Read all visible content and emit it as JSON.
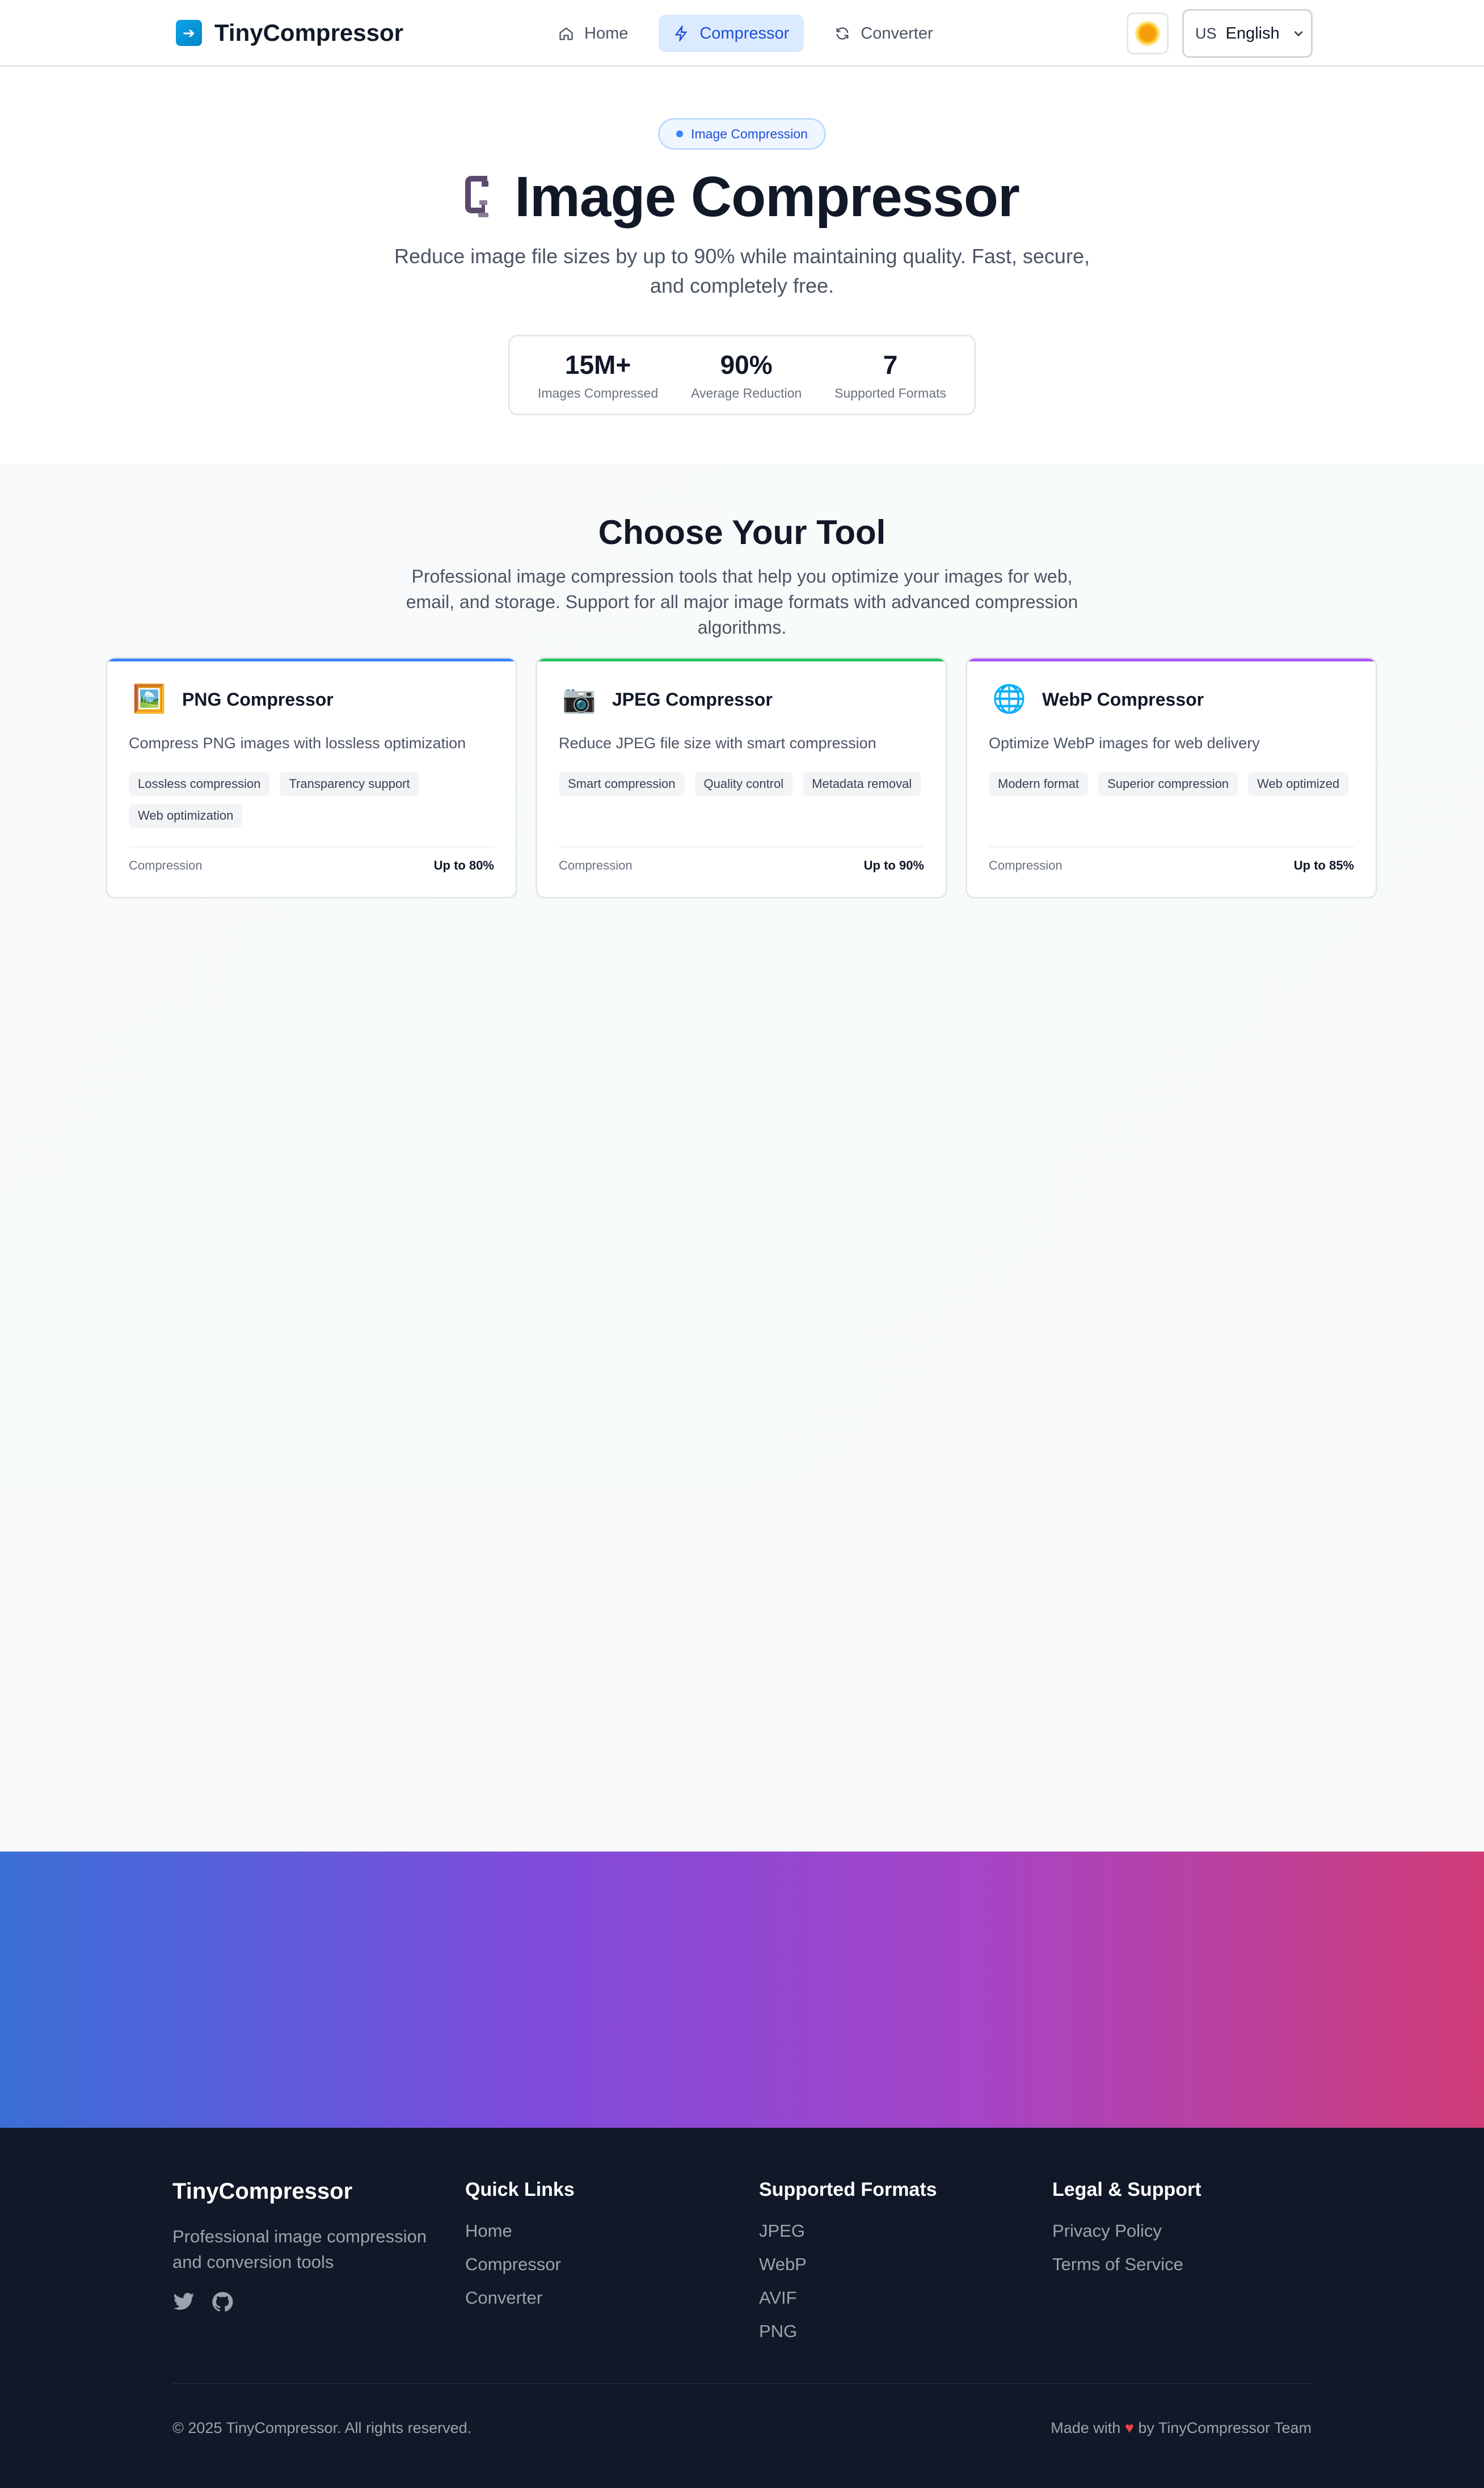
{
  "app": {
    "brand": "TinyCompressor"
  },
  "nav": {
    "items": [
      {
        "label": "Home",
        "icon": "home-icon",
        "active": false
      },
      {
        "label": "Compressor",
        "icon": "lightning-icon",
        "active": true
      },
      {
        "label": "Converter",
        "icon": "refresh-icon",
        "active": false
      }
    ],
    "theme_icon": "sun-icon",
    "language": {
      "flag": "US",
      "label": "English"
    }
  },
  "hero": {
    "badge": "Image Compression",
    "title": "Image Compressor",
    "subtitle": "Reduce image file sizes by up to 90% while maintaining quality. Fast, secure, and completely free.",
    "stats": [
      {
        "value": "15M+",
        "label": "Images Compressed"
      },
      {
        "value": "90%",
        "label": "Average Reduction"
      },
      {
        "value": "7",
        "label": "Supported Formats"
      }
    ]
  },
  "tools": {
    "title": "Choose Your Tool",
    "subtitle": "Professional image compression tools that help you optimize your images for web, email, and storage. Support for all major image formats with advanced compression algorithms.",
    "cards": [
      {
        "icon": "🖼️",
        "title": "PNG Compressor",
        "description": "Compress PNG images with lossless optimization",
        "tags": [
          "Lossless compression",
          "Transparency support",
          "Web optimization"
        ],
        "footer_label": "Compression",
        "footer_value": "Up to 80%",
        "accent": "#3b82f6"
      },
      {
        "icon": "📷",
        "title": "JPEG Compressor",
        "description": "Reduce JPEG file size with smart compression",
        "tags": [
          "Smart compression",
          "Quality control",
          "Metadata removal"
        ],
        "footer_label": "Compression",
        "footer_value": "Up to 90%",
        "accent": "#22c55e"
      },
      {
        "icon": "🌐",
        "title": "WebP Compressor",
        "description": "Optimize WebP images for web delivery",
        "tags": [
          "Modern format",
          "Superior compression",
          "Web optimized"
        ],
        "footer_label": "Compression",
        "footer_value": "Up to 85%",
        "accent": "#a855f7"
      }
    ]
  },
  "footer": {
    "brand": "TinyCompressor",
    "description": "Professional image compression and conversion tools",
    "social": [
      "twitter-icon",
      "github-icon"
    ],
    "quick_links": {
      "title": "Quick Links",
      "items": [
        "Home",
        "Compressor",
        "Converter"
      ]
    },
    "formats": {
      "title": "Supported Formats",
      "items": [
        "JPEG",
        "WebP",
        "AVIF",
        "PNG"
      ]
    },
    "legal": {
      "title": "Legal & Support",
      "items": [
        "Privacy Policy",
        "Terms of Service"
      ]
    },
    "copyright": "© 2025 TinyCompressor. All rights reserved.",
    "made_prefix": "Made with",
    "made_heart": "♥",
    "made_suffix": "by TinyCompressor Team"
  },
  "colors": {
    "primary": "#1d4ed8",
    "footer_bg": "#111827",
    "gradient": [
      "#3b6fd8",
      "#7d4bdb",
      "#a545c8",
      "#d03d78"
    ]
  }
}
